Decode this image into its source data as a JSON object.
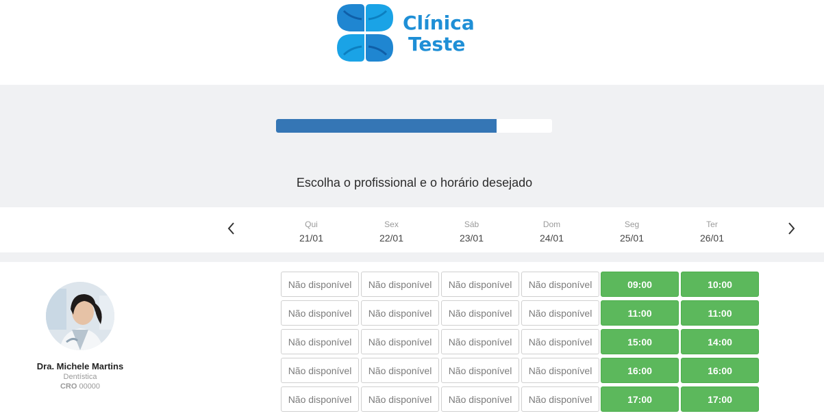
{
  "brand": {
    "line1": "Clínica",
    "line2": "Teste"
  },
  "progress": {
    "value": 0.8
  },
  "page": {
    "title": "Escolha o profissional e o horário desejado"
  },
  "days": [
    {
      "weekday": "Qui",
      "date": "21/01"
    },
    {
      "weekday": "Sex",
      "date": "22/01"
    },
    {
      "weekday": "Sáb",
      "date": "23/01"
    },
    {
      "weekday": "Dom",
      "date": "24/01"
    },
    {
      "weekday": "Seg",
      "date": "25/01"
    },
    {
      "weekday": "Ter",
      "date": "26/01"
    }
  ],
  "professional": {
    "name": "Dra. Michele Martins",
    "specialty": "Dentística",
    "cro_label": "CRO",
    "cro_value": "00000"
  },
  "slots": [
    [
      "Não disponível",
      "Não disponível",
      "Não disponível",
      "Não disponível",
      "Não disponível"
    ],
    [
      "Não disponível",
      "Não disponível",
      "Não disponível",
      "Não disponível",
      "Não disponível"
    ],
    [
      "Não disponível",
      "Não disponível",
      "Não disponível",
      "Não disponível",
      "Não disponível"
    ],
    [
      "Não disponível",
      "Não disponível",
      "Não disponível",
      "Não disponível",
      "Não disponível"
    ],
    [
      "09:00",
      "11:00",
      "15:00",
      "16:00",
      "17:00"
    ],
    [
      "10:00",
      "11:00",
      "14:00",
      "16:00",
      "17:00"
    ]
  ],
  "colors": {
    "available": "#5cb85c",
    "progress": "#3576b5",
    "brand": "#1f8fd6"
  }
}
